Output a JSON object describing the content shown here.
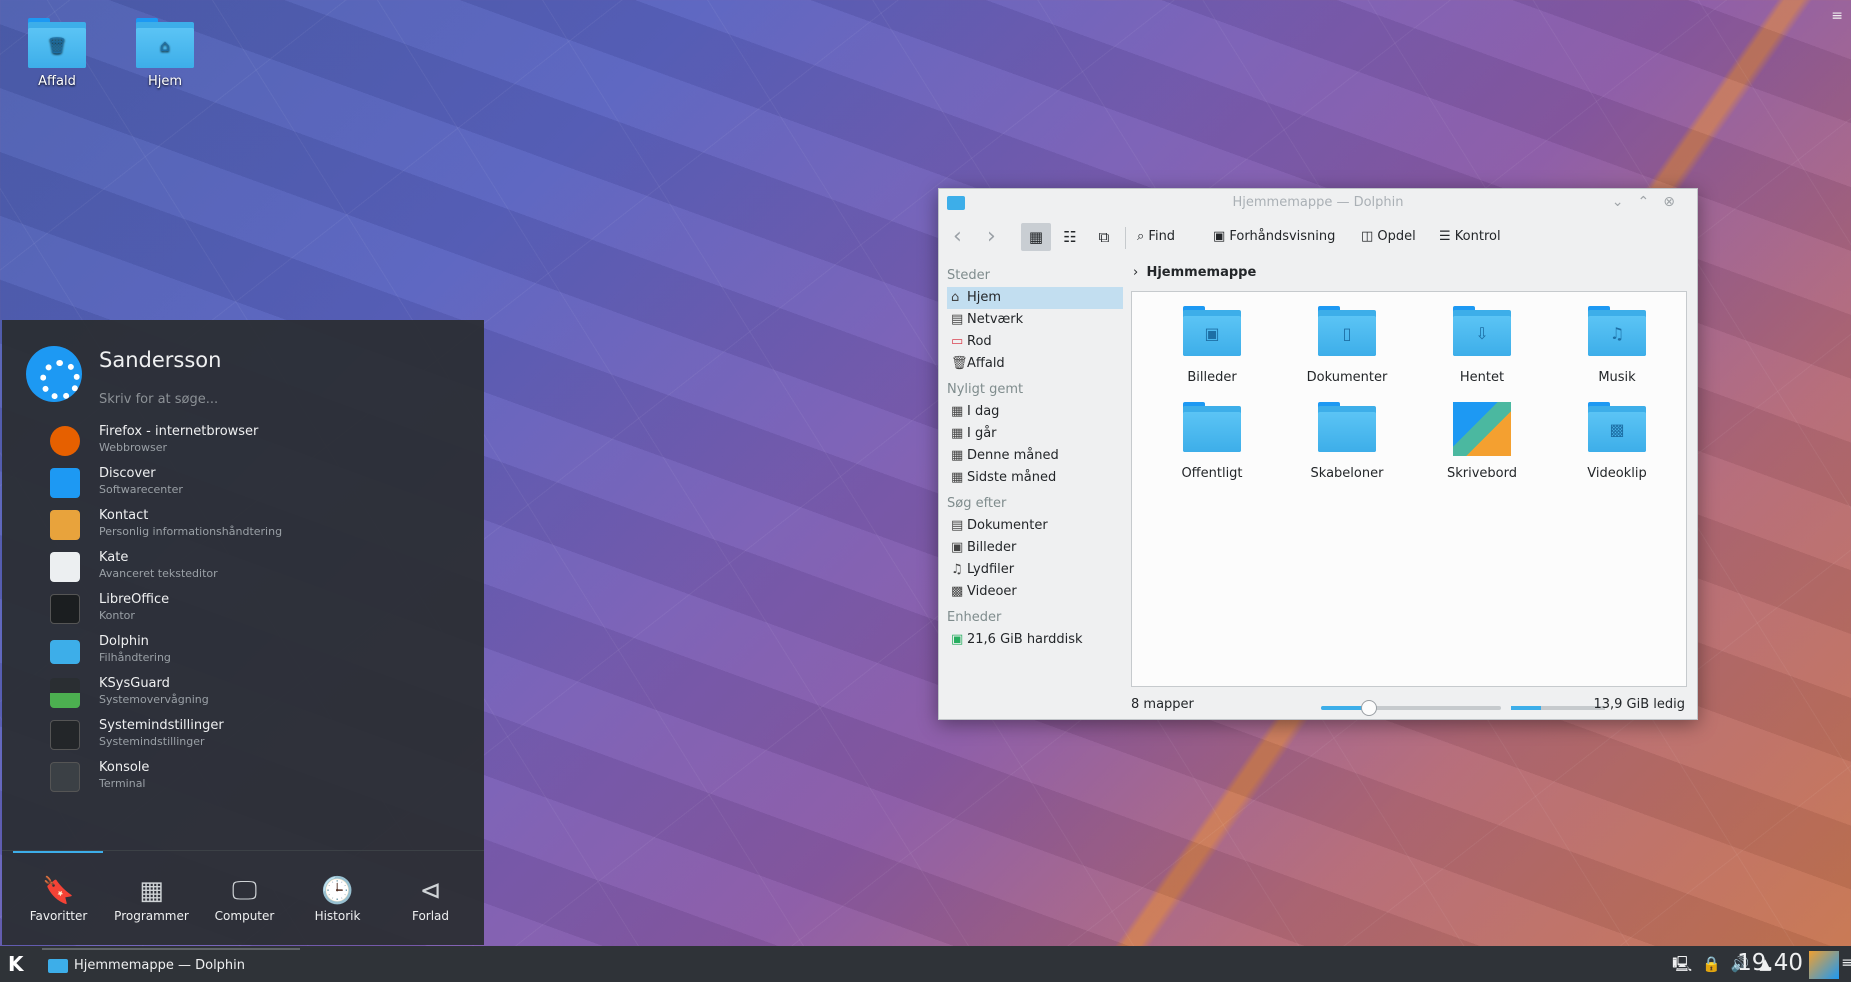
{
  "desktop": {
    "icons": [
      {
        "label": "Affald",
        "glyph": "🗑"
      },
      {
        "label": "Hjem",
        "glyph": "⌂"
      }
    ],
    "corner_menu_icon": "≡"
  },
  "kickoff": {
    "user": "Sandersson",
    "search_placeholder": "Skriv for at søge...",
    "apps": [
      {
        "name": "Firefox - internetbrowser",
        "desc": "Webbrowser",
        "icon": "firefox-icon",
        "color": "#e66000"
      },
      {
        "name": "Discover",
        "desc": "Softwarecenter",
        "icon": "discover-icon",
        "color": "#1d99f3"
      },
      {
        "name": "Kontact",
        "desc": "Personlig informationshåndtering",
        "icon": "kontact-icon",
        "color": "#e8a33c"
      },
      {
        "name": "Kate",
        "desc": "Avanceret teksteditor",
        "icon": "kate-icon",
        "color": "#eceff1"
      },
      {
        "name": "LibreOffice",
        "desc": "Kontor",
        "icon": "libreoffice-icon",
        "color": "#2a2e32"
      },
      {
        "name": "Dolphin",
        "desc": "Filhåndtering",
        "icon": "dolphin-icon",
        "color": "#3daee9"
      },
      {
        "name": "KSysGuard",
        "desc": "Systemovervågning",
        "icon": "ksysguard-icon",
        "color": "#4caf50"
      },
      {
        "name": "Systemindstillinger",
        "desc": "Systemindstillinger",
        "icon": "settings-icon",
        "color": "#31363b"
      },
      {
        "name": "Konsole",
        "desc": "Terminal",
        "icon": "konsole-icon",
        "color": "#3b4045"
      }
    ],
    "tabs": [
      {
        "label": "Favoritter",
        "glyph": "🔖"
      },
      {
        "label": "Programmer",
        "glyph": "▦"
      },
      {
        "label": "Computer",
        "glyph": "🖵"
      },
      {
        "label": "Historik",
        "glyph": "🕒"
      },
      {
        "label": "Forlad",
        "glyph": "⊲"
      }
    ]
  },
  "taskbar": {
    "start_glyph": "K",
    "task_label": "Hjemmemappe — Dolphin",
    "tray_glyphs": "🖳🔒🔊▲",
    "clock": "19.40",
    "menu_glyph": "≡"
  },
  "dolphin": {
    "title": "Hjemmemappe — Dolphin",
    "window_buttons": "⌄⌃⊗",
    "toolbar": {
      "back": "‹",
      "forward": "›",
      "view_icons": "▦",
      "view_compact": "☷",
      "view_details": "⧉",
      "find": "Find",
      "preview": "Forhåndsvisning",
      "split": "Opdel",
      "control": "Kontrol"
    },
    "places": {
      "steder_head": "Steder",
      "steder": [
        {
          "label": "Hjem",
          "glyph": "⌂"
        },
        {
          "label": "Netværk",
          "glyph": "▤"
        },
        {
          "label": "Rod",
          "glyph": "▭"
        },
        {
          "label": "Affald",
          "glyph": "🗑"
        }
      ],
      "recent_head": "Nyligt gemt",
      "recent": [
        {
          "label": "I dag",
          "glyph": "▦"
        },
        {
          "label": "I går",
          "glyph": "▦"
        },
        {
          "label": "Denne måned",
          "glyph": "▦"
        },
        {
          "label": "Sidste måned",
          "glyph": "▦"
        }
      ],
      "search_head": "Søg efter",
      "search": [
        {
          "label": "Dokumenter",
          "glyph": "▤"
        },
        {
          "label": "Billeder",
          "glyph": "▣"
        },
        {
          "label": "Lydfiler",
          "glyph": "♫"
        },
        {
          "label": "Videoer",
          "glyph": "▩"
        }
      ],
      "devices_head": "Enheder",
      "devices": [
        {
          "label": "21,6 GiB harddisk",
          "glyph": "▣"
        }
      ]
    },
    "breadcrumb": "Hjemmemappe",
    "files": [
      {
        "label": "Billeder",
        "glyph": "▣"
      },
      {
        "label": "Dokumenter",
        "glyph": "▯"
      },
      {
        "label": "Hentet",
        "glyph": "⇩"
      },
      {
        "label": "Musik",
        "glyph": "♫"
      },
      {
        "label": "Offentligt",
        "glyph": ""
      },
      {
        "label": "Skabeloner",
        "glyph": ""
      },
      {
        "label": "Skrivebord",
        "glyph": ""
      },
      {
        "label": "Videoklip",
        "glyph": "▩"
      }
    ],
    "status": {
      "count": "8 mapper",
      "free": "13,9 GiB ledig"
    }
  }
}
